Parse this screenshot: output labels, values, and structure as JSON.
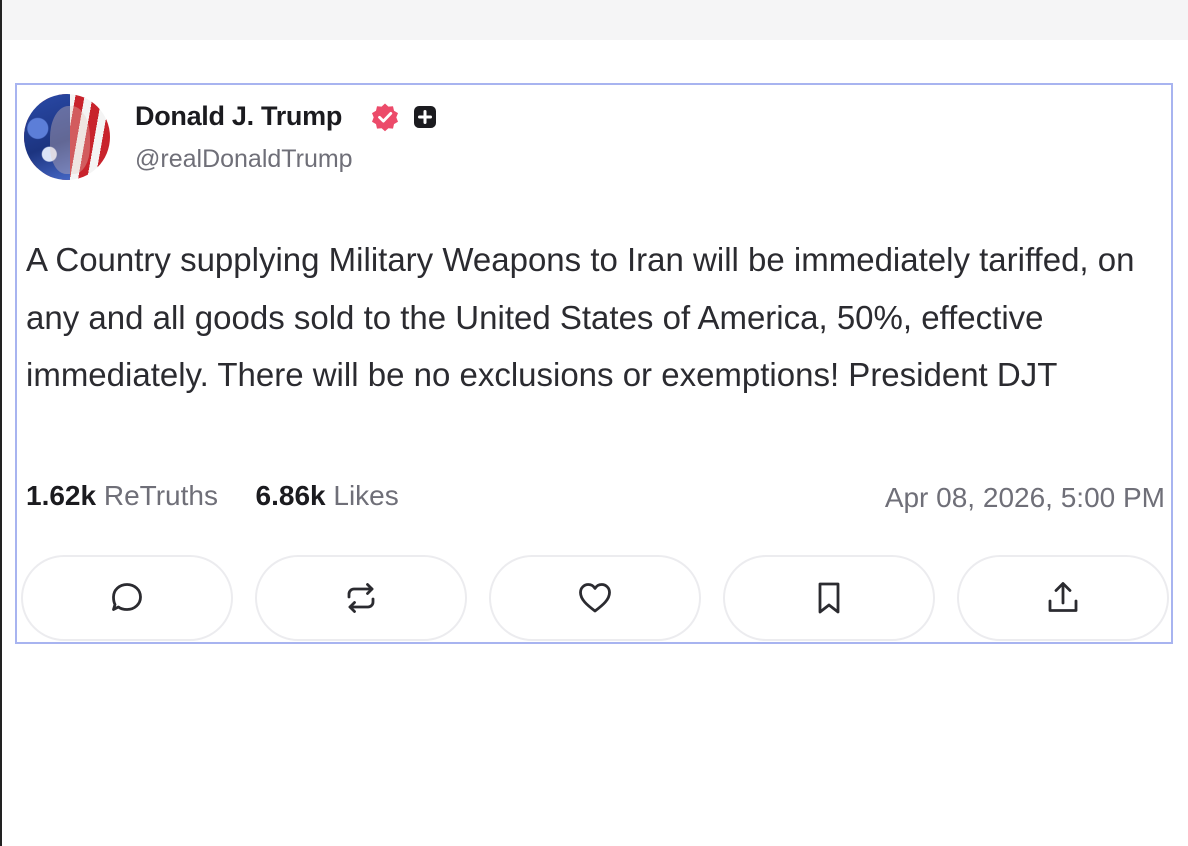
{
  "post": {
    "display_name": "Donald J. Trump",
    "handle": "@realDonaldTrump",
    "text": "A Country supplying Military Weapons to Iran will be immediately tariffed, on any and all goods sold to the United States of America, 50%, effective immediately. There will be no exclusions or exemptions! President DJT",
    "retruths_count": "1.62k",
    "retruths_label": "ReTruths",
    "likes_count": "6.86k",
    "likes_label": "Likes",
    "timestamp": "Apr 08, 2026, 5:00 PM"
  },
  "actions": [
    {
      "icon": "reply-icon"
    },
    {
      "icon": "retruth-icon"
    },
    {
      "icon": "heart-icon"
    },
    {
      "icon": "bookmark-icon"
    },
    {
      "icon": "share-icon"
    }
  ],
  "colors": {
    "verified_badge": "#ec4b6a",
    "card_border": "#a8b4f0",
    "text_primary": "#1b1b1f",
    "text_secondary": "#6f6f78"
  }
}
